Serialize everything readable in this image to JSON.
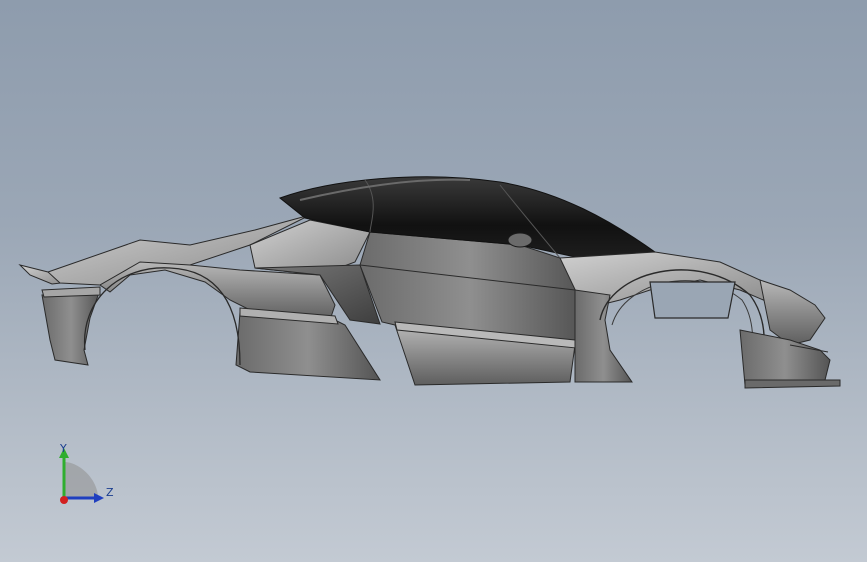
{
  "viewport": {
    "background_top": "#8e9cad",
    "background_bottom": "#c3cad3"
  },
  "model": {
    "body_color": "#8c8c8c",
    "canopy_color": "#1c1c1c"
  },
  "triad": {
    "y_label": "Y",
    "z_label": "Z",
    "y_color": "#2fae2f",
    "z_color": "#1f3fbf",
    "x_color": "#d22020"
  }
}
